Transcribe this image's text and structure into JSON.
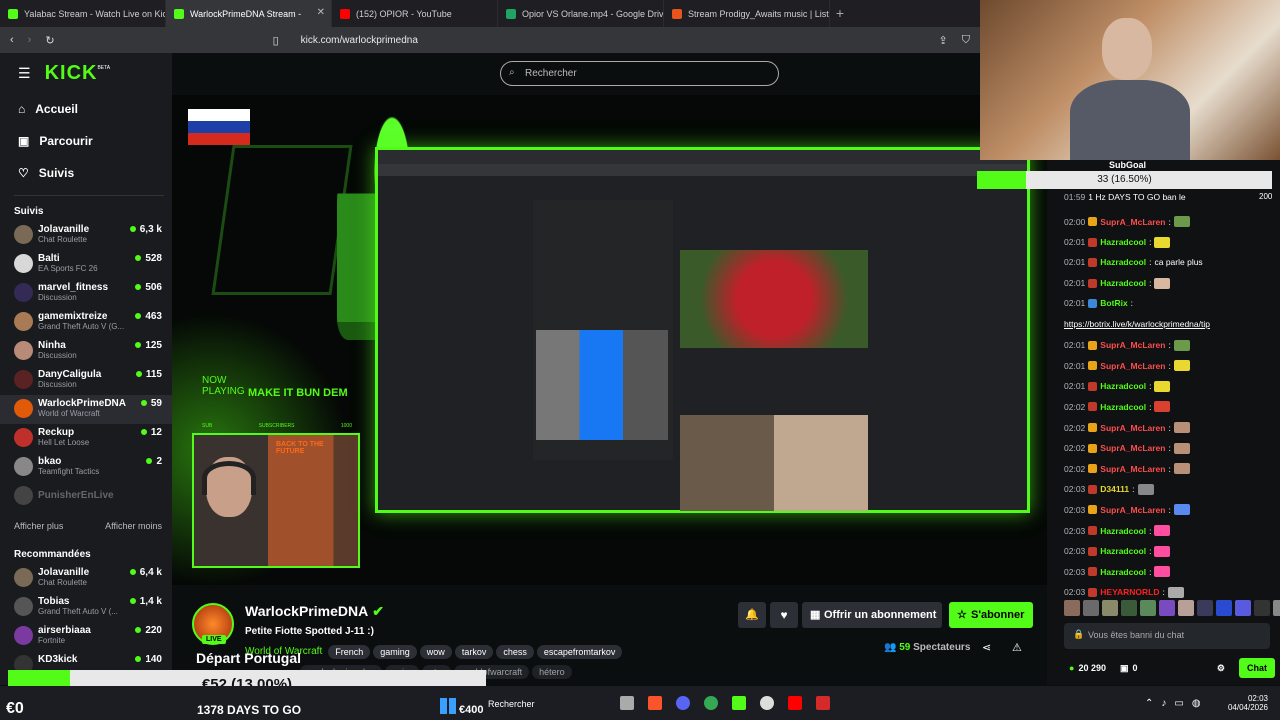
{
  "browser": {
    "tabs": [
      {
        "label": "Yalabac Stream - Watch Live on Kick",
        "fav": "#53fc18"
      },
      {
        "label": "WarlockPrimeDNA Stream - ",
        "fav": "#53fc18"
      },
      {
        "label": "(152) OPIOR - YouTube",
        "fav": "#ff0000"
      },
      {
        "label": "Opior VS Orlane.mp4 - Google Drive",
        "fav": "#1fa463"
      },
      {
        "label": "Stream Prodigy_Awaits music | List",
        "fav": "#e8541c"
      }
    ],
    "url": "kick.com/warlockprimedna"
  },
  "kick": {
    "logo": "KICK",
    "beta": "BETA",
    "nav": [
      "Accueil",
      "Parcourir",
      "Suivis"
    ],
    "search_placeholder": "Rechercher",
    "following_header": "Suivis",
    "show_more": "Afficher plus",
    "show_less": "Afficher moins",
    "recommended_header": "Recommandées",
    "following": [
      {
        "name": "Jolavanille",
        "game": "Chat Roulette",
        "viewers": "6,3 k",
        "c": "#7a6a55"
      },
      {
        "name": "Balti",
        "game": "EA Sports FC 26",
        "viewers": "528",
        "c": "#d8d8d8"
      },
      {
        "name": "marvel_fitness",
        "game": "Discussion",
        "viewers": "506",
        "c": "#332a55"
      },
      {
        "name": "gamemixtreize",
        "game": "Grand Theft Auto V (G...",
        "viewers": "463",
        "c": "#a87a55"
      },
      {
        "name": "Ninha",
        "game": "Discussion",
        "viewers": "125",
        "c": "#b88a78"
      },
      {
        "name": "DanyCaligula",
        "game": "Discussion",
        "viewers": "115",
        "c": "#5a2222"
      },
      {
        "name": "WarlockPrimeDNA",
        "game": "World of Warcraft",
        "viewers": "59",
        "c": "#e05a0a"
      },
      {
        "name": "Reckup",
        "game": "Hell Let Loose",
        "viewers": "12",
        "c": "#c0302a"
      },
      {
        "name": "bkao",
        "game": "Teamfight Tactics",
        "viewers": "2",
        "c": "#888"
      }
    ],
    "offline": "PunisherEnLive",
    "recommended": [
      {
        "name": "Jolavanille",
        "game": "Chat Roulette",
        "viewers": "6,4 k",
        "c": "#7a6a55"
      },
      {
        "name": "Tobias",
        "game": "Grand Theft Auto V (...",
        "viewers": "1,4 k",
        "c": "#555"
      },
      {
        "name": "airserbiaaa",
        "game": "Fortnite",
        "viewers": "220",
        "c": "#7a3aa0"
      },
      {
        "name": "KD3kick",
        "game": "",
        "viewers": "140",
        "c": "#333"
      }
    ]
  },
  "overlay": {
    "now": "NOW",
    "playing": "PLAYING",
    "track": "MAKE IT BUN DEM",
    "stats": [
      "SUB",
      "SUBSCRIBERS",
      "1000"
    ],
    "book": "BACK TO THE FUTURE"
  },
  "stream": {
    "name": "WarlockPrimeDNA",
    "live": "LIVE",
    "title": "Petite Fiotte Spotted J-11 :)",
    "category": "World of Warcraft",
    "tags": [
      "French",
      "gaming",
      "wow",
      "tarkov",
      "chess",
      "escapefromtarkov"
    ],
    "tags2": [
      "warlockprimedna",
      "opior",
      "ptm",
      "worldofwarcraft",
      "hétero"
    ],
    "follow_icon": "heart-icon",
    "gift": "Offrir un abonnement",
    "subscribe": "S'abonner",
    "viewers": "59",
    "viewers_label": "Spectateurs",
    "accent": "#53fc18"
  },
  "chat": {
    "subgoal": "SubGoal",
    "subgoal_value": "33 (16.50%)",
    "goal_max": "200",
    "first_msg": "1 Hz DAYS TO GO ban le",
    "banned": "Vous êtes banni du chat",
    "points": "20 290",
    "chests": "0",
    "chat_button": "Chat",
    "messages": [
      {
        "t": "02:00",
        "u": "SuprA_McLaren",
        "c": "#ff4d4d",
        "b": "#e8a317",
        "m": "",
        "e": "#6a9a4a"
      },
      {
        "t": "02:01",
        "u": "Hazradcool",
        "c": "#53fc18",
        "b": "#c0392b",
        "m": "",
        "e": "#e8d830"
      },
      {
        "t": "02:01",
        "u": "Hazradcool",
        "c": "#53fc18",
        "b": "#c0392b",
        "m": "ca parle plus",
        "e": ""
      },
      {
        "t": "02:01",
        "u": "Hazradcool",
        "c": "#53fc18",
        "b": "#c0392b",
        "m": "",
        "e": "#d8b8a0"
      },
      {
        "t": "02:01",
        "u": "BotRix",
        "c": "#53fc18",
        "b": "#3a8ad8",
        "m": "",
        "e": ""
      },
      {
        "t": "",
        "u": "",
        "c": "",
        "b": "",
        "m": "https://botrix.live/k/warlockprimedna/tip",
        "e": ""
      },
      {
        "t": "02:01",
        "u": "SuprA_McLaren",
        "c": "#ff4d4d",
        "b": "#e8a317",
        "m": "",
        "e": "#6a9a4a"
      },
      {
        "t": "02:01",
        "u": "SuprA_McLaren",
        "c": "#ff4d4d",
        "b": "#e8a317",
        "m": "",
        "e": "#e8d830"
      },
      {
        "t": "02:01",
        "u": "Hazradcool",
        "c": "#53fc18",
        "b": "#c0392b",
        "m": "",
        "e": "#e8d830"
      },
      {
        "t": "02:02",
        "u": "Hazradcool",
        "c": "#53fc18",
        "b": "#c0392b",
        "m": "",
        "e": "#d84030"
      },
      {
        "t": "02:02",
        "u": "SuprA_McLaren",
        "c": "#ff4d4d",
        "b": "#e8a317",
        "m": "",
        "e": "#b89078"
      },
      {
        "t": "02:02",
        "u": "SuprA_McLaren",
        "c": "#ff4d4d",
        "b": "#e8a317",
        "m": "",
        "e": "#b89078"
      },
      {
        "t": "02:02",
        "u": "SuprA_McLaren",
        "c": "#ff4d4d",
        "b": "#e8a317",
        "m": "",
        "e": "#b89078"
      },
      {
        "t": "02:03",
        "u": "D34111",
        "c": "#e8d830",
        "b": "#c0392b",
        "m": "",
        "e": "#888"
      },
      {
        "t": "02:03",
        "u": "SuprA_McLaren",
        "c": "#ff4d4d",
        "b": "#e8a317",
        "m": "",
        "e": "#5a8af0"
      },
      {
        "t": "02:03",
        "u": "Hazradcool",
        "c": "#53fc18",
        "b": "#c0392b",
        "m": "",
        "e": "#ff4da0"
      },
      {
        "t": "02:03",
        "u": "Hazradcool",
        "c": "#53fc18",
        "b": "#c0392b",
        "m": "",
        "e": "#ff4da0"
      },
      {
        "t": "02:03",
        "u": "Hazradcool",
        "c": "#53fc18",
        "b": "#c0392b",
        "m": "",
        "e": "#ff4da0"
      },
      {
        "t": "02:03",
        "u": "HEYARNORLD",
        "c": "#ff2020",
        "b": "#c0392b",
        "m": "",
        "e": "#aaa"
      }
    ]
  },
  "bottom": {
    "departure": "Départ Portugal",
    "euro_left": "€0",
    "goal": "€52 (13.00%)",
    "days": "1378 DAYS TO GO",
    "euro_right": "€400",
    "goal_pct": 0.13,
    "search": "Rechercher",
    "time": "02:03",
    "date": "04/04/2026"
  }
}
